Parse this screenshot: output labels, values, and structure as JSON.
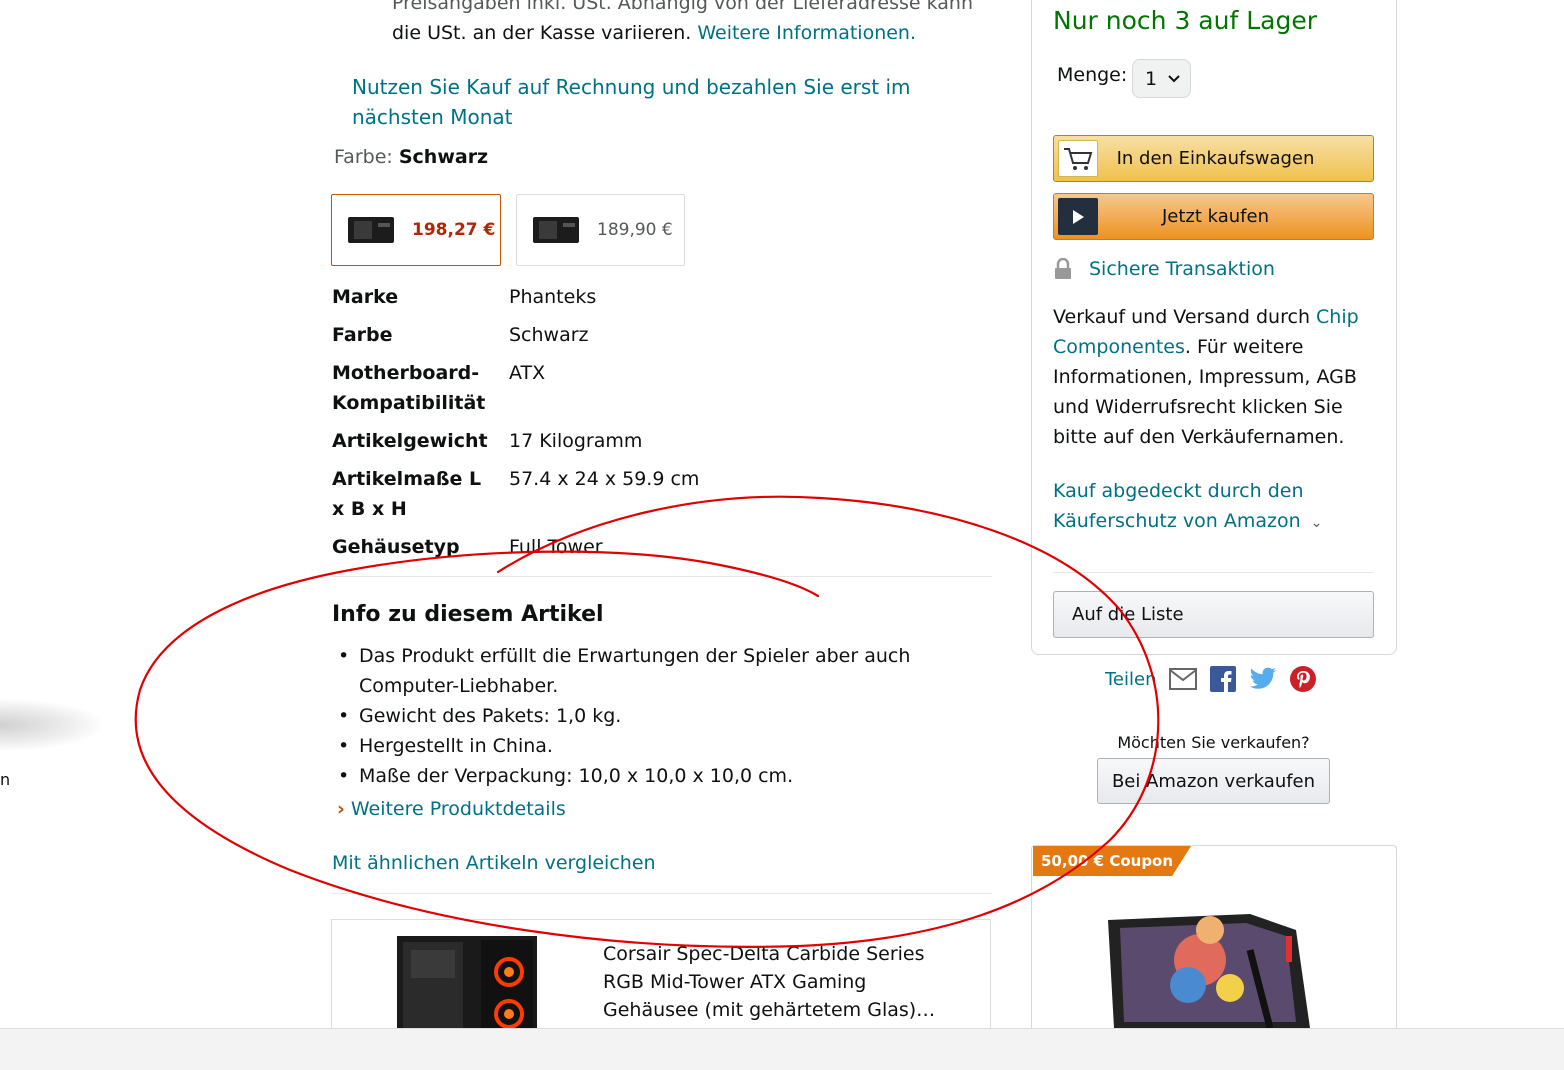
{
  "price_note": {
    "line1": "Preisangaben inkl. USt. Abhängig von der Lieferadresse kann",
    "line2_prefix": "die USt. an der Kasse variieren. ",
    "line2_link": "Weitere Informationen."
  },
  "invoice_offer": "Nutzen Sie Kauf auf Rechnung und bezahlen Sie erst im nächsten Monat",
  "color": {
    "label": "Farbe: ",
    "value": "Schwarz"
  },
  "swatches": [
    {
      "price": "198,27 €",
      "selected": true
    },
    {
      "price": "189,90 €",
      "selected": false
    }
  ],
  "specs": [
    {
      "key": "Marke",
      "value": "Phanteks"
    },
    {
      "key": "Farbe",
      "value": "Schwarz"
    },
    {
      "key": "Motherboard-Kompatibilität",
      "value": "ATX"
    },
    {
      "key": "Artikelgewicht",
      "value": "17 Kilogramm"
    },
    {
      "key": "Artikelmaße L x B x H",
      "value": "57.4 x 24 x 59.9 cm"
    },
    {
      "key": "Gehäusetyp",
      "value": "Full Tower"
    }
  ],
  "info": {
    "title": "Info zu diesem Artikel",
    "bullets": [
      "Das Produkt erfüllt die Erwartungen der Spieler aber auch Computer-Liebhaber.",
      "Gewicht des Pakets: 1,0 kg.",
      "Hergestellt in China.",
      "Maße der Verpackung: 10,0 x 10,0 x 10,0 cm."
    ],
    "more_details": "Weitere Produktdetails",
    "compare": "Mit ähnlichen Artikeln vergleichen"
  },
  "related_product": {
    "title": "Corsair Spec-Delta Carbide Series RGB Mid-Tower ATX Gaming Gehäusee (mit gehärtetem Glas)…"
  },
  "buybox": {
    "stock": "Nur noch 3 auf Lager",
    "qty_label": "Menge:",
    "qty_value": "1",
    "add_to_cart": "In den Einkaufswagen",
    "buy_now": "Jetzt kaufen",
    "secure": "Sichere Transaktion",
    "sold_by_prefix": "Verkauf und Versand durch ",
    "seller": "Chip Componentes",
    "sold_by_suffix": ". Für weitere Informationen, Impressum, AGB und Widerrufsrecht klicken Sie bitte auf den Verkäufernamen.",
    "protection": "Kauf abgedeckt durch den Käuferschutz von Amazon",
    "add_to_list": "Auf die Liste"
  },
  "share": {
    "label": "Teilen"
  },
  "sell": {
    "question": "Möchten Sie verkaufen?",
    "button": "Bei Amazon verkaufen"
  },
  "ad": {
    "coupon": "50,00 € Coupon"
  },
  "left_fragment": "n",
  "colors": {
    "link": "#007185",
    "in_stock": "#007600",
    "price_red": "#b12704",
    "annotation": "#e00000"
  }
}
